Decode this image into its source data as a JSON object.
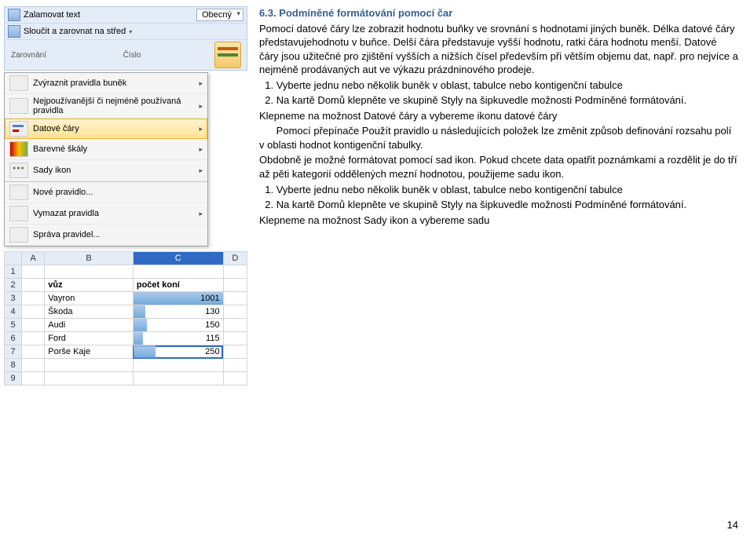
{
  "heading": "6.3. Podmíněné formátování pomocí čar",
  "body": {
    "p1": "Pomocí datové čáry lze zobrazit hodnotu buňky ve srovnání s hodnotami jiných buněk. Délka datové čáry představujehodnotu v buňce. Delší čára představuje vyšší hodnotu, ratki čára hodnotu menší. Datové čáry jsou užitečné pro zjištění vyšších a nižších čísel především při větším objemu dat, např. pro nejvíce a nejméně prodávaných aut ve výkazu prázdninového prodeje.",
    "step1": "  1. Vyberte jednu nebo několik buněk v oblast, tabulce nebo kontigenční tabulce",
    "step2a": "  2. Na kartě Domů klepněte ve skupině Styly na šipkuvedle možnosti Podmíněné formátování.",
    "step2b": "Klepneme na možnost Datové čáry a vybereme ikonu datové čáry",
    "step2c": "      Pomocí přepínače Použít pravidlo u následujících položek lze změnit způsob definování rozsahu polí v oblasti hodnot kontigenční tabulky.",
    "p2": "Obdobně je možné formátovat pomocí sad ikon. Pokud chcete data opatřit poznámkami a rozdělit je do tří až pěti kategorií oddělených mezní hodnotou, použijeme sadu ikon.",
    "step3": "  1. Vyberte jednu nebo několik buněk v oblast, tabulce nebo kontigenční tabulce",
    "step4": "  2. Na kartě Domů klepněte ve skupině Styly na šipkuvedle možnosti Podmíněné formátování.",
    "p3": "Klepneme na možnost Sady ikon a vybereme sadu"
  },
  "ribbon": {
    "wrap": "Zalamovat text",
    "merge": "Sloučit a zarovnat na střed",
    "align_group": "Zarovnání",
    "number_format": "Obecný",
    "number_group": "Číslo"
  },
  "menu": {
    "highlight_rules": "Zvýraznit pravidla buněk",
    "top_bottom": "Nejpoužívanější či nejméně používaná pravidla",
    "data_bars": "Datové čáry",
    "color_scales": "Barevné škály",
    "icon_sets": "Sady ikon",
    "new_rule": "Nové pravidlo...",
    "clear_rules": "Vymazat pravidla",
    "manage_rules": "Správa pravidel..."
  },
  "sheet": {
    "cols": [
      "A",
      "B",
      "C",
      "D"
    ],
    "headers": {
      "b": "vůz",
      "c": "počet koní"
    },
    "rows": [
      {
        "n": "1",
        "label": "",
        "val": ""
      },
      {
        "n": "2",
        "label": "",
        "val": ""
      },
      {
        "n": "3",
        "label": "Vayron",
        "val": "1001"
      },
      {
        "n": "4",
        "label": "Škoda",
        "val": "130"
      },
      {
        "n": "5",
        "label": "Audi",
        "val": "150"
      },
      {
        "n": "6",
        "label": "Ford",
        "val": "115"
      },
      {
        "n": "7",
        "label": "Porše Kaje",
        "val": "250"
      },
      {
        "n": "8",
        "label": "",
        "val": ""
      },
      {
        "n": "9",
        "label": "",
        "val": ""
      }
    ]
  },
  "page_number": "14",
  "chart_data": {
    "type": "bar",
    "title": "počet koní",
    "categories": [
      "Vayron",
      "Škoda",
      "Audi",
      "Ford",
      "Porše Kaje"
    ],
    "values": [
      1001,
      130,
      150,
      115,
      250
    ],
    "xlabel": "vůz",
    "ylabel": "počet koní",
    "ylim": [
      0,
      1001
    ]
  }
}
